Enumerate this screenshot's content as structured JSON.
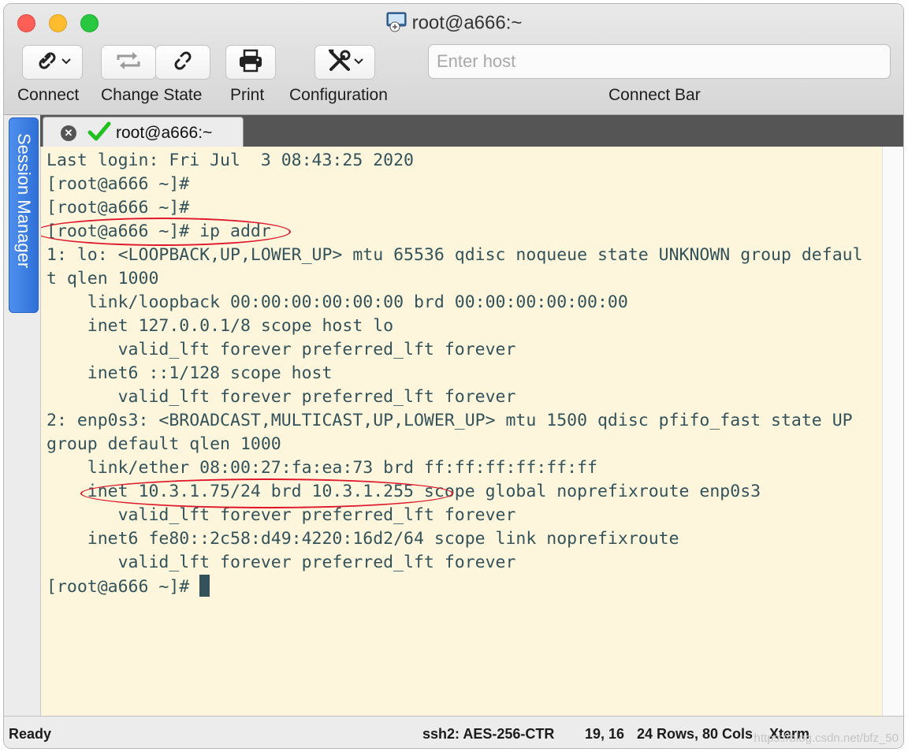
{
  "window": {
    "title": "root@a666:~"
  },
  "toolbar": {
    "connect_label": "Connect",
    "change_state_label": "Change State",
    "print_label": "Print",
    "configuration_label": "Configuration",
    "connect_bar_label": "Connect Bar",
    "host_placeholder": "Enter host",
    "host_value": ""
  },
  "session_manager": {
    "label": "Session Manager"
  },
  "tabs": [
    {
      "label": "root@a666:~",
      "status_icon": "check-icon",
      "close_icon": "close-icon"
    }
  ],
  "terminal": {
    "lines": [
      "Last login: Fri Jul  3 08:43:25 2020",
      "[root@a666 ~]#",
      "[root@a666 ~]#",
      "[root@a666 ~]# ip addr",
      "1: lo: <LOOPBACK,UP,LOWER_UP> mtu 65536 qdisc noqueue state UNKNOWN group defaul",
      "t qlen 1000",
      "    link/loopback 00:00:00:00:00:00 brd 00:00:00:00:00:00",
      "    inet 127.0.0.1/8 scope host lo",
      "       valid_lft forever preferred_lft forever",
      "    inet6 ::1/128 scope host",
      "       valid_lft forever preferred_lft forever",
      "2: enp0s3: <BROADCAST,MULTICAST,UP,LOWER_UP> mtu 1500 qdisc pfifo_fast state UP",
      "group default qlen 1000",
      "    link/ether 08:00:27:fa:ea:73 brd ff:ff:ff:ff:ff:ff",
      "    inet 10.3.1.75/24 brd 10.3.1.255 scope global noprefixroute enp0s3",
      "       valid_lft forever preferred_lft forever",
      "    inet6 fe80::2c58:d49:4220:16d2/64 scope link noprefixroute",
      "       valid_lft forever preferred_lft forever"
    ],
    "prompt": "[root@a666 ~]# ",
    "text_color": "#33525a",
    "background_color": "#fdf6dc",
    "annotation_color": "#e0162b"
  },
  "statusbar": {
    "status": "Ready",
    "cipher": "ssh2: AES-256-CTR",
    "cursor_pos": "19, 16",
    "size": "24 Rows, 80 Cols",
    "terminal_type": "Xterm",
    "watermark": "https://blog.csdn.net/bfz_50"
  },
  "colors": {
    "session_tab": "#3d7fe4",
    "check": "#20c020",
    "close_red": "#fd5f57",
    "minimize_yellow": "#febc2e",
    "maximize_green": "#28c840"
  }
}
